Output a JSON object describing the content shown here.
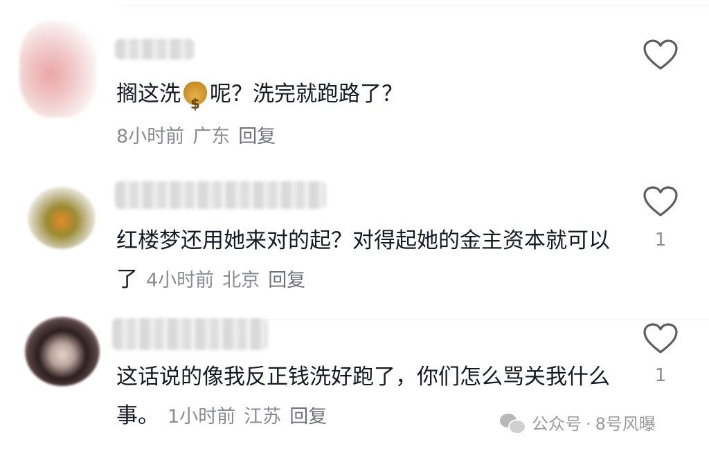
{
  "comments": [
    {
      "text_before_emoji": "搁这洗",
      "emoji": "money-bag",
      "text_after_emoji": "呢？洗完就跑路了？",
      "time": "8小时前",
      "location": "广东",
      "reply_label": "回复",
      "like_count": ""
    },
    {
      "text": "红楼梦还用她来对的起？对得起她的金主资本就可以了",
      "time": "4小时前",
      "location": "北京",
      "reply_label": "回复",
      "like_count": "1"
    },
    {
      "text": "这话说的像我反正钱洗好跑了，你们怎么骂关我什么事。",
      "time": "1小时前",
      "location": "江苏",
      "reply_label": "回复",
      "like_count": "1"
    }
  ],
  "watermark": {
    "label": "公众号",
    "separator": "·",
    "account": "8号风曝"
  },
  "icons": {
    "like": "heart-outline-icon",
    "watermark": "wechat-icon"
  },
  "colors": {
    "text_primary": "#161823",
    "text_secondary": "#8a8b91",
    "heart_stroke": "#5c5d63"
  }
}
